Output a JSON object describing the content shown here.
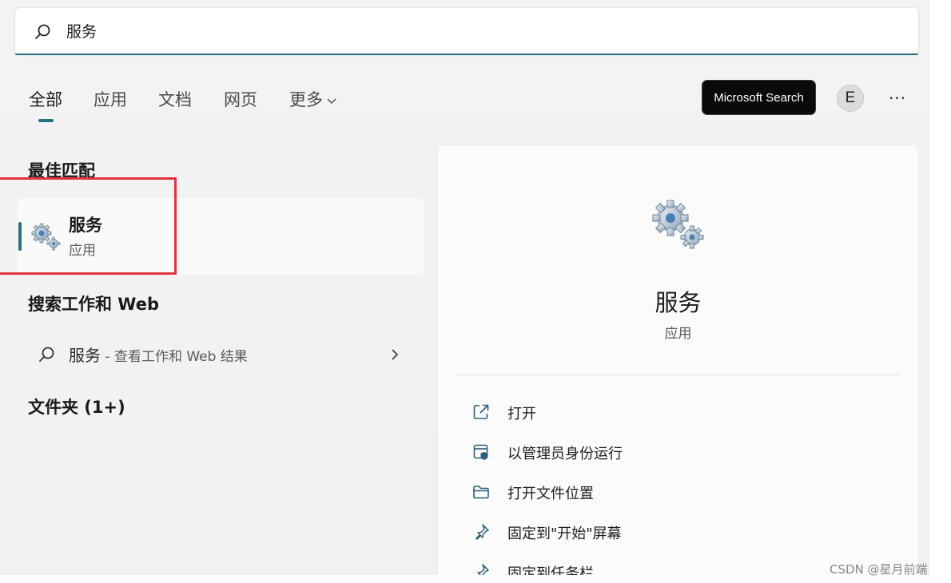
{
  "search": {
    "value": "服务"
  },
  "tabs": [
    {
      "label": "全部",
      "active": true
    },
    {
      "label": "应用"
    },
    {
      "label": "文档"
    },
    {
      "label": "网页"
    },
    {
      "label": "更多"
    }
  ],
  "header_right": {
    "ms_search_label": "Microsoft Search",
    "avatar_letter": "E",
    "more_label": "···"
  },
  "sections": {
    "best_match": "最佳匹配",
    "search_web": "搜索工作和 Web",
    "folders": "文件夹 (1+)"
  },
  "best_match_item": {
    "title": "服务",
    "subtitle": "应用"
  },
  "web_result": {
    "query": "服务",
    "suffix": " - 查看工作和 Web 结果"
  },
  "detail": {
    "title": "服务",
    "subtitle": "应用",
    "actions": [
      {
        "label": "打开",
        "icon": "open-external-icon"
      },
      {
        "label": "以管理员身份运行",
        "icon": "shield-window-icon"
      },
      {
        "label": "打开文件位置",
        "icon": "folder-icon"
      },
      {
        "label": "固定到\"开始\"屏幕",
        "icon": "pin-icon"
      },
      {
        "label": "固定到任务栏",
        "icon": "pin-icon"
      }
    ]
  },
  "colors": {
    "accent": "#2b6f83",
    "highlight": "#e0353a"
  },
  "watermark": "CSDN @星月前端"
}
